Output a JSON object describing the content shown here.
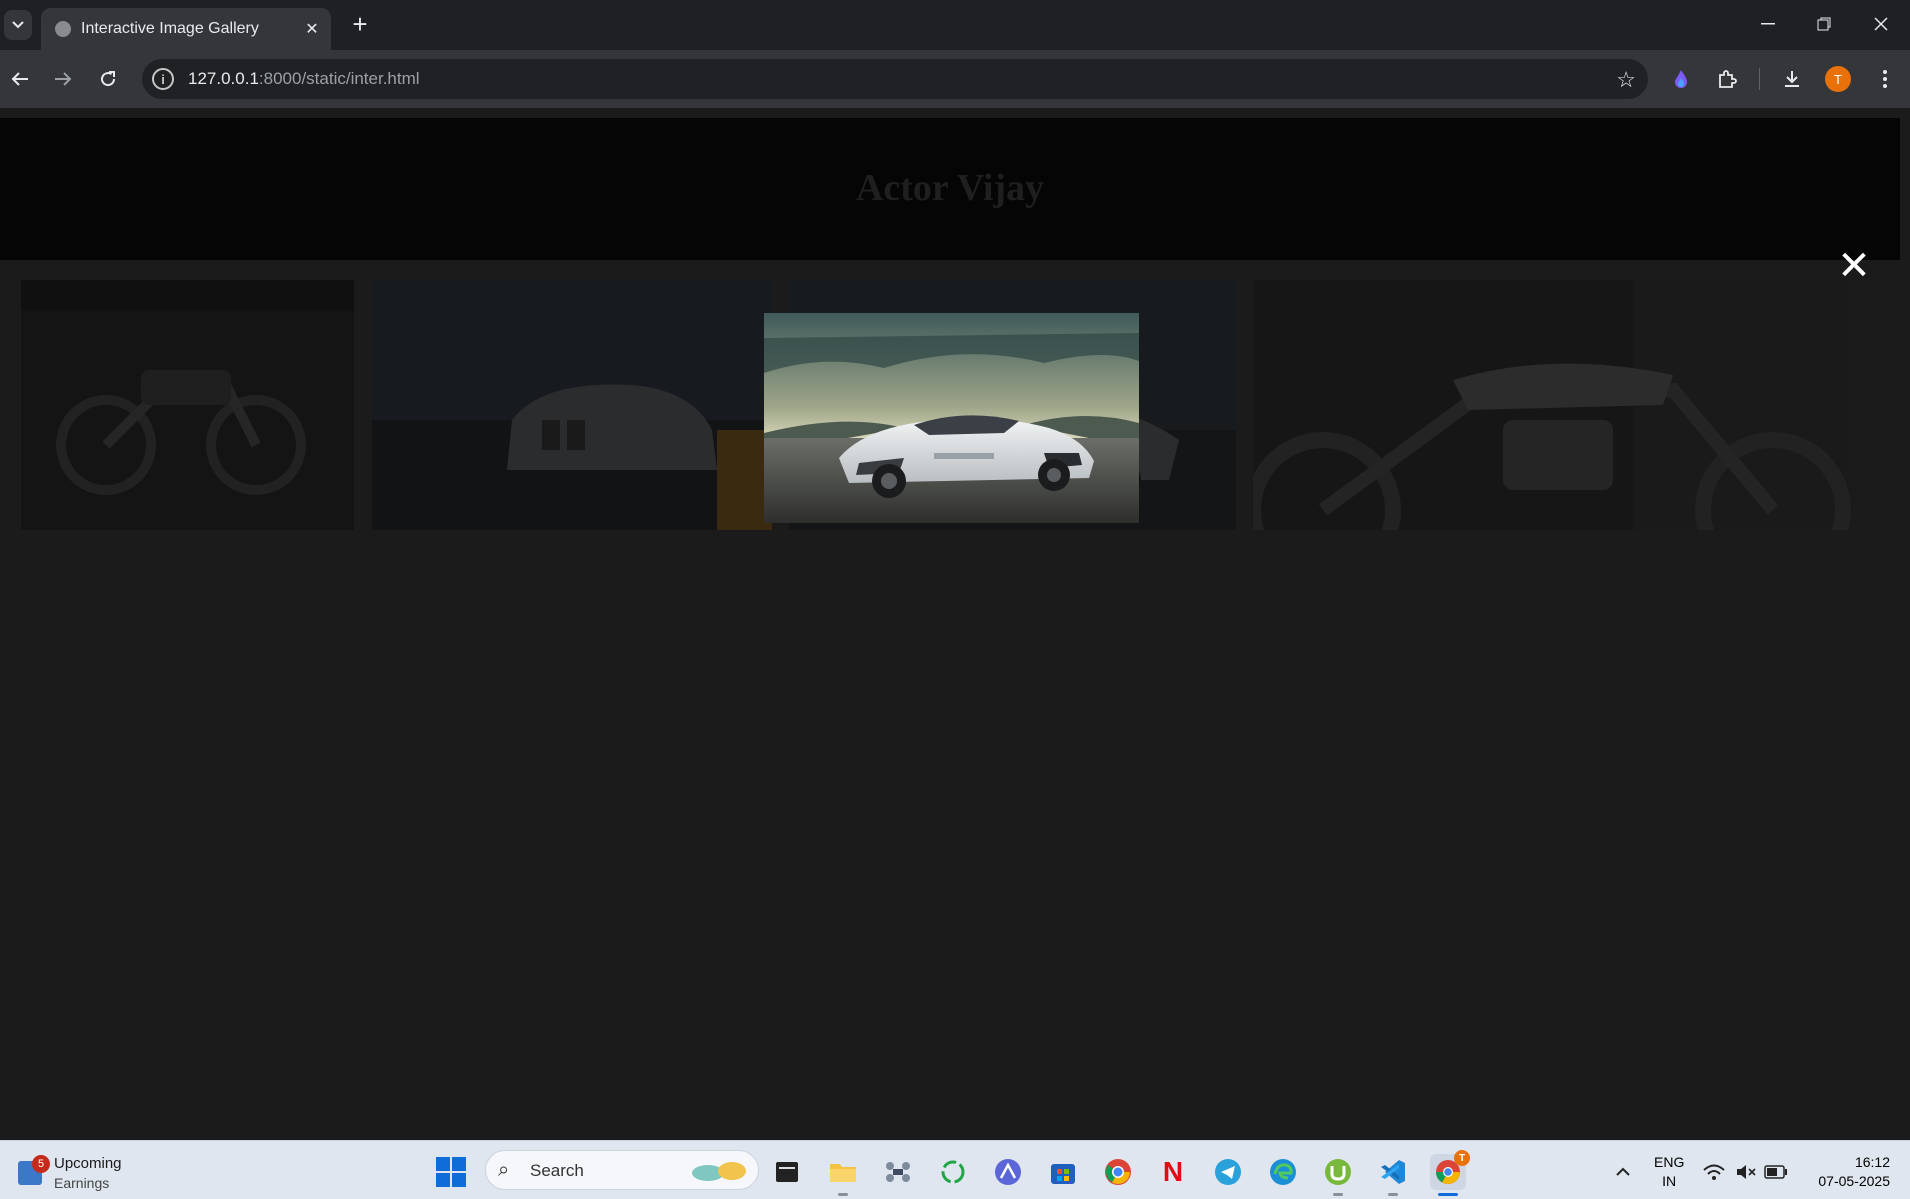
{
  "browser": {
    "tab_title": "Interactive Image Gallery",
    "url_host": "127.0.0.1",
    "url_path": ":8000/static/inter.html",
    "profile_initial": "T"
  },
  "page": {
    "title": "Actor Vijay",
    "thumbnails": [
      {
        "subject": "motorcycle"
      },
      {
        "subject": "white-bmw-car"
      },
      {
        "subject": "white-lamborghini-car"
      },
      {
        "subject": "royal-enfield-motorcycle"
      }
    ],
    "lightbox": {
      "close_symbol": "✕",
      "image_subject": "white-lamborghini-car"
    }
  },
  "taskbar": {
    "widget_badge": "5",
    "widget_title": "Upcoming",
    "widget_subtitle": "Earnings",
    "search_placeholder": "Search",
    "chrome_badge": "T",
    "lang_line1": "ENG",
    "lang_line2": "IN",
    "time": "16:12",
    "date": "07-05-2025",
    "apps": [
      "terminal",
      "file-explorer",
      "drone-app",
      "refresh-app",
      "arc-app",
      "microsoft-store",
      "chrome",
      "netflix",
      "telegram",
      "edge",
      "utorrent",
      "vscode",
      "chrome-profile"
    ]
  },
  "colors": {
    "accent": "#0f6cd8",
    "profile": "#e8710a",
    "netflix": "#e50914"
  }
}
